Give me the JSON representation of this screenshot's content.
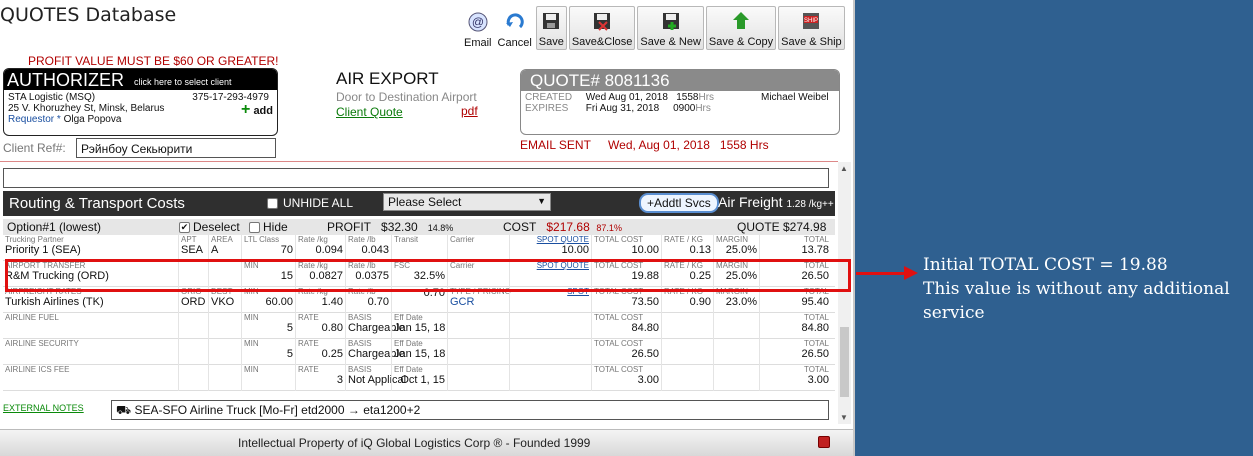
{
  "app_title": "QUOTES Database",
  "toolbar": [
    {
      "label": "Email",
      "icon": "email-icon",
      "boxed": false
    },
    {
      "label": "Cancel",
      "icon": "cancel-icon",
      "boxed": false
    },
    {
      "label": "Save",
      "icon": "save-icon",
      "boxed": true
    },
    {
      "label": "Save&Close",
      "icon": "save-close-icon",
      "boxed": true
    },
    {
      "label": "Save & New",
      "icon": "save-new-icon",
      "boxed": true
    },
    {
      "label": "Save & Copy",
      "icon": "save-copy-icon",
      "boxed": true
    },
    {
      "label": "Save & Ship",
      "icon": "save-ship-icon",
      "boxed": true
    }
  ],
  "profit_warning": "PROFIT VALUE MUST BE $60 OR GREATER!",
  "authorizer": {
    "title": "AUTHORIZER",
    "hint": "click here to select client",
    "company": "STA Logistic (MSQ)",
    "phone": "375-17-293-4979",
    "address": "25 V. Khoruzhey St, Minsk, Belarus",
    "requestor_label": "Requestor *",
    "requestor": "Olga Popova",
    "add_label": "add"
  },
  "export": {
    "type": "AIR EXPORT",
    "service": "Door to Destination Airport",
    "client_quote_link": "Client Quote",
    "pdf_link": "pdf"
  },
  "quote": {
    "number": "QUOTE# 8081136",
    "created_label": "CREATED",
    "created_date": "Wed Aug 01, 2018",
    "created_time": "1558",
    "expires_label": "EXPIRES",
    "expires_date": "Fri Aug 31, 2018",
    "expires_time": "0900",
    "hrs": "Hrs",
    "user": "Michael Weibel"
  },
  "client_ref_label": "Client Ref#:",
  "client_ref_value": "Рэйнбоу Секьюрити",
  "email_sent": {
    "label": "EMAIL SENT",
    "date": "Wed, Aug 01, 2018",
    "time": "1558 Hrs"
  },
  "routing": {
    "title": "Routing & Transport Costs",
    "unhide_label": "UNHIDE ALL",
    "select_value": "Please Select",
    "addtl_label": "+Addtl Svcs",
    "freight_label": "Air Freight",
    "freight_rate": "1.28 /kg++"
  },
  "option": {
    "label": "Option#1 (lowest)",
    "deselect": "Deselect",
    "hide": "Hide",
    "profit_label": "PROFIT",
    "profit_value": "$32.30",
    "profit_pct": "14.8%",
    "cost_label": "COST",
    "cost_value": "$217.68",
    "cost_pct": "87.1%",
    "quote_total": "QUOTE $274.98"
  },
  "rows": [
    {
      "name": "trucking-partner-row",
      "cells": [
        {
          "h": "Trucking Partner",
          "v": "Priority 1 (SEA)"
        },
        {
          "h": "APT",
          "v": "SEA"
        },
        {
          "h": "AREA",
          "v": "A"
        },
        {
          "h": "LTL Class",
          "v": "70"
        },
        {
          "h": "Rate /kg",
          "v": "0.094"
        },
        {
          "h": "Rate /lb",
          "v": "0.043"
        },
        {
          "h": "Transit",
          "v": ""
        },
        {
          "h": "Carrier",
          "v": ""
        },
        {
          "h": "SPOT QUOTE",
          "v": "10.00"
        },
        {
          "h": "TOTAL COST",
          "v": "10.00"
        },
        {
          "h": "RATE / KG",
          "v": "0.13"
        },
        {
          "h": "MARGIN",
          "v": "25.0%"
        },
        {
          "h": "TOTAL",
          "v": "13.78"
        }
      ]
    },
    {
      "name": "airport-transfer-row",
      "cells": [
        {
          "h": "AIRPORT TRANSFER",
          "v": "R&M Trucking (ORD)"
        },
        {
          "h": "",
          "v": ""
        },
        {
          "h": "",
          "v": ""
        },
        {
          "h": "MIN",
          "v": "15"
        },
        {
          "h": "Rate /kg",
          "v": "0.0827"
        },
        {
          "h": "Rate /lb",
          "v": "0.0375"
        },
        {
          "h": "FSC",
          "v": "32.5%"
        },
        {
          "h": "Carrier",
          "v": ""
        },
        {
          "h": "SPOT QUOTE",
          "v": ""
        },
        {
          "h": "TOTAL COST",
          "v": "19.88"
        },
        {
          "h": "RATE / KG",
          "v": "0.25"
        },
        {
          "h": "MARGIN",
          "v": "25.0%"
        },
        {
          "h": "TOTAL",
          "v": "26.50"
        }
      ]
    },
    {
      "name": "airline-rates-row",
      "cells": [
        {
          "h": "AIRFREIGHT RATES",
          "v": "Turkish Airlines (TK)"
        },
        {
          "h": "ORIG",
          "v": "ORD"
        },
        {
          "h": "DEST",
          "v": "VKO"
        },
        {
          "h": "MIN",
          "v": "60.00"
        },
        {
          "h": "Rate /kg",
          "v": "1.40"
        },
        {
          "h": "Rate /lb",
          "v": "0.70"
        },
        {
          "h": "",
          "v": "0.70"
        },
        {
          "h": "TYPE / PRICING",
          "v": "GCR"
        },
        {
          "h": "SPOT",
          "v": ""
        },
        {
          "h": "TOTAL COST",
          "v": "73.50"
        },
        {
          "h": "RATE / KG",
          "v": "0.90"
        },
        {
          "h": "MARGIN",
          "v": "23.0%"
        },
        {
          "h": "TOTAL",
          "v": "95.40"
        }
      ]
    },
    {
      "name": "airline-fuel-row",
      "cells": [
        {
          "h": "AIRLINE FUEL",
          "v": ""
        },
        {
          "h": "",
          "v": ""
        },
        {
          "h": "",
          "v": ""
        },
        {
          "h": "MIN",
          "v": "5"
        },
        {
          "h": "RATE",
          "v": "0.80"
        },
        {
          "h": "BASIS",
          "v": "Chargeable"
        },
        {
          "h": "Eff Date",
          "v": "Jan 15, 18"
        },
        {
          "h": "",
          "v": ""
        },
        {
          "h": "",
          "v": ""
        },
        {
          "h": "TOTAL COST",
          "v": "84.80"
        },
        {
          "h": "",
          "v": ""
        },
        {
          "h": "",
          "v": ""
        },
        {
          "h": "TOTAL",
          "v": "84.80"
        }
      ]
    },
    {
      "name": "airline-security-row",
      "cells": [
        {
          "h": "AIRLINE SECURITY",
          "v": ""
        },
        {
          "h": "",
          "v": ""
        },
        {
          "h": "",
          "v": ""
        },
        {
          "h": "MIN",
          "v": "5"
        },
        {
          "h": "RATE",
          "v": "0.25"
        },
        {
          "h": "BASIS",
          "v": "Chargeable"
        },
        {
          "h": "Eff Date",
          "v": "Jan 15, 18"
        },
        {
          "h": "",
          "v": ""
        },
        {
          "h": "",
          "v": ""
        },
        {
          "h": "TOTAL COST",
          "v": "26.50"
        },
        {
          "h": "",
          "v": ""
        },
        {
          "h": "",
          "v": ""
        },
        {
          "h": "TOTAL",
          "v": "26.50"
        }
      ]
    },
    {
      "name": "airline-ics-fee-row",
      "cells": [
        {
          "h": "AIRLINE ICS FEE",
          "v": ""
        },
        {
          "h": "",
          "v": ""
        },
        {
          "h": "",
          "v": ""
        },
        {
          "h": "MIN",
          "v": ""
        },
        {
          "h": "RATE",
          "v": "3"
        },
        {
          "h": "BASIS",
          "v": "Not Applical"
        },
        {
          "h": "Eff Date",
          "v": "Oct 1, 15"
        },
        {
          "h": "",
          "v": ""
        },
        {
          "h": "",
          "v": ""
        },
        {
          "h": "TOTAL COST",
          "v": "3.00"
        },
        {
          "h": "",
          "v": ""
        },
        {
          "h": "",
          "v": ""
        },
        {
          "h": "TOTAL",
          "v": "3.00"
        }
      ]
    }
  ],
  "external_notes_label": "EXTERNAL NOTES",
  "external_notes_value": "SEA-SFO  Airline Truck [Mo-Fr]  etd2000 → eta1200+2",
  "footer": "Intellectual Property of iQ Global Logistics Corp ® - Founded 1999",
  "annotation": {
    "line1": "Initial TOTAL COST = 19.88",
    "line2": "This value is without any additional service"
  }
}
